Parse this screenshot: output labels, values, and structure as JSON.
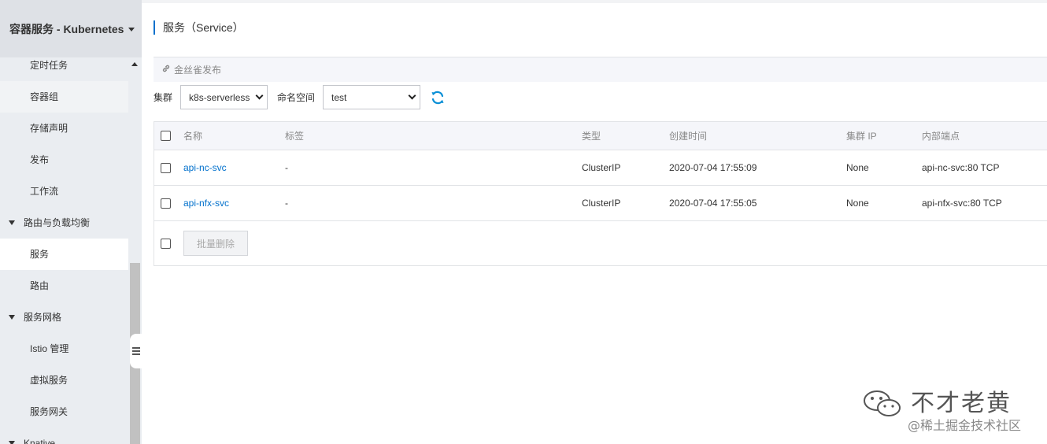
{
  "sidebar": {
    "header_title": "容器服务 - Kubernetes",
    "items": [
      {
        "label": "定时任务"
      },
      {
        "label": "容器组"
      },
      {
        "label": "存储声明"
      },
      {
        "label": "发布"
      },
      {
        "label": "工作流"
      }
    ],
    "group_routing": "路由与负载均衡",
    "routing_items": [
      {
        "label": "服务"
      },
      {
        "label": "路由"
      }
    ],
    "group_mesh": "服务网格",
    "mesh_items": [
      {
        "label": "Istio 管理"
      },
      {
        "label": "虚拟服务"
      },
      {
        "label": "服务网关"
      }
    ],
    "group_knative": "Knative"
  },
  "main": {
    "page_title": "服务（Service）",
    "canary_label": "金丝雀发布",
    "cluster_label": "集群",
    "cluster_value": "k8s-serverless",
    "namespace_label": "命名空间",
    "namespace_value": "test",
    "table": {
      "headers": {
        "name": "名称",
        "labels": "标签",
        "type": "类型",
        "created": "创建时间",
        "cluster_ip": "集群 IP",
        "endpoint": "内部端点"
      },
      "rows": [
        {
          "name": "api-nc-svc",
          "labels": "-",
          "type": "ClusterIP",
          "created": "2020-07-04 17:55:09",
          "cluster_ip": "None",
          "endpoint": "api-nc-svc:80 TCP"
        },
        {
          "name": "api-nfx-svc",
          "labels": "-",
          "type": "ClusterIP",
          "created": "2020-07-04 17:55:05",
          "cluster_ip": "None",
          "endpoint": "api-nfx-svc:80 TCP"
        }
      ],
      "batch_delete": "批量删除"
    }
  },
  "watermark": {
    "name": "不才老黄",
    "sub": "@稀土掘金技术社区"
  },
  "colors": {
    "accent": "#0070cc",
    "brand": "#ff6a00",
    "refresh": "#0a8fd6"
  }
}
